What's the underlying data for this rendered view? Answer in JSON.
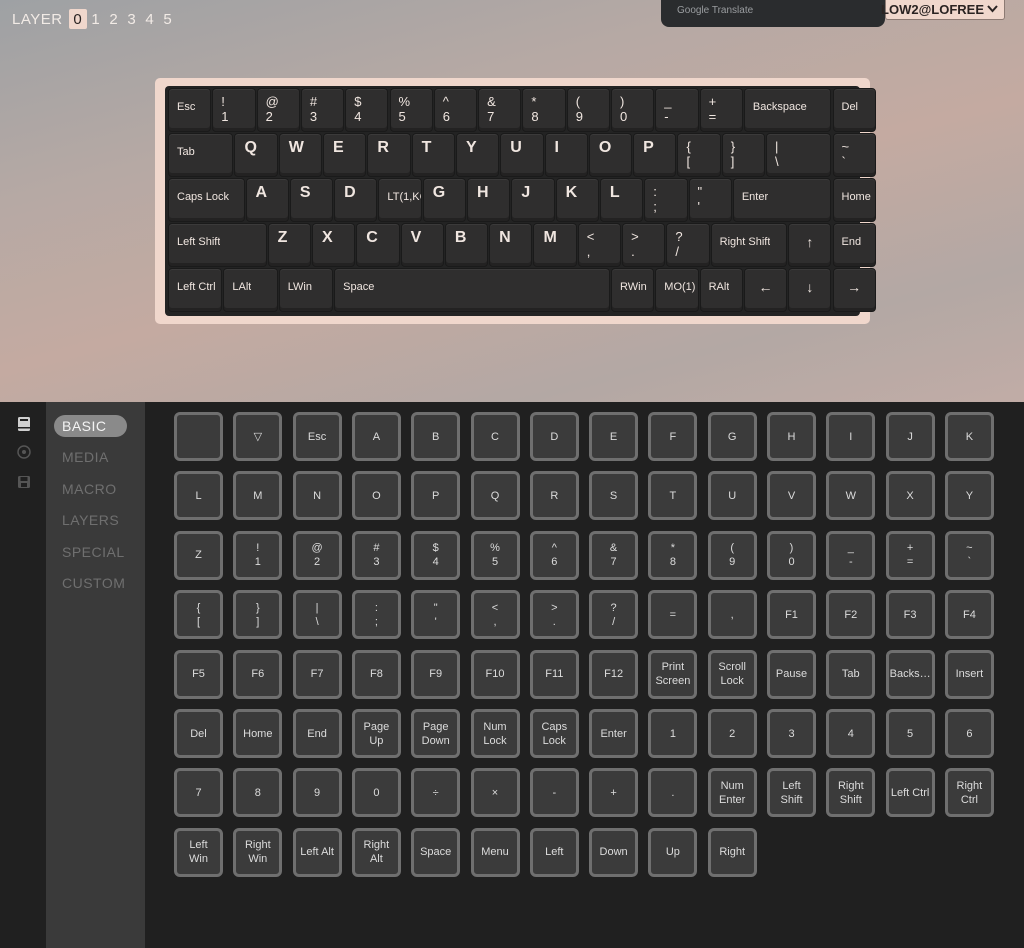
{
  "layer_selector": {
    "label": "LAYER",
    "layers": [
      "0",
      "1",
      "2",
      "3",
      "4",
      "5"
    ],
    "active": "0"
  },
  "popup": {
    "label": "Google Translate"
  },
  "device": {
    "name": "LOW2@LOFREE"
  },
  "keyboard": {
    "rows": [
      [
        {
          "label": "Esc",
          "w": 1
        },
        {
          "label": "!\n1",
          "w": 1
        },
        {
          "label": "@\n2",
          "w": 1
        },
        {
          "label": "#\n3",
          "w": 1
        },
        {
          "label": "$\n4",
          "w": 1
        },
        {
          "label": "%\n5",
          "w": 1
        },
        {
          "label": "^\n6",
          "w": 1
        },
        {
          "label": "&\n7",
          "w": 1
        },
        {
          "label": "*\n8",
          "w": 1
        },
        {
          "label": "(\n9",
          "w": 1
        },
        {
          "label": ")\n0",
          "w": 1
        },
        {
          "label": "_\n-",
          "w": 1
        },
        {
          "label": "+\n=",
          "w": 1
        },
        {
          "label": "Backspace",
          "w": 2
        },
        {
          "label": "Del",
          "w": 1
        }
      ],
      [
        {
          "label": "Tab",
          "w": 1.5
        },
        {
          "label": "Q",
          "w": 1,
          "big": true
        },
        {
          "label": "W",
          "w": 1,
          "big": true
        },
        {
          "label": "E",
          "w": 1,
          "big": true
        },
        {
          "label": "R",
          "w": 1,
          "big": true
        },
        {
          "label": "T",
          "w": 1,
          "big": true
        },
        {
          "label": "Y",
          "w": 1,
          "big": true
        },
        {
          "label": "U",
          "w": 1,
          "big": true
        },
        {
          "label": "I",
          "w": 1,
          "big": true
        },
        {
          "label": "O",
          "w": 1,
          "big": true
        },
        {
          "label": "P",
          "w": 1,
          "big": true
        },
        {
          "label": "{\n[",
          "w": 1
        },
        {
          "label": "}\n]",
          "w": 1
        },
        {
          "label": "|\n\\",
          "w": 1.5
        },
        {
          "label": "~\n`",
          "w": 1
        }
      ],
      [
        {
          "label": "Caps Lock",
          "w": 1.75
        },
        {
          "label": "A",
          "w": 1,
          "big": true
        },
        {
          "label": "S",
          "w": 1,
          "big": true
        },
        {
          "label": "D",
          "w": 1,
          "big": true
        },
        {
          "label": "LT(1,KC",
          "w": 1
        },
        {
          "label": "G",
          "w": 1,
          "big": true
        },
        {
          "label": "H",
          "w": 1,
          "big": true
        },
        {
          "label": "J",
          "w": 1,
          "big": true
        },
        {
          "label": "K",
          "w": 1,
          "big": true
        },
        {
          "label": "L",
          "w": 1,
          "big": true
        },
        {
          "label": ":\n;",
          "w": 1
        },
        {
          "label": "\"\n'",
          "w": 1
        },
        {
          "label": "Enter",
          "w": 2.25
        },
        {
          "label": "Home",
          "w": 1
        }
      ],
      [
        {
          "label": "Left Shift",
          "w": 2.25
        },
        {
          "label": "Z",
          "w": 1,
          "big": true
        },
        {
          "label": "X",
          "w": 1,
          "big": true
        },
        {
          "label": "C",
          "w": 1,
          "big": true
        },
        {
          "label": "V",
          "w": 1,
          "big": true
        },
        {
          "label": "B",
          "w": 1,
          "big": true
        },
        {
          "label": "N",
          "w": 1,
          "big": true
        },
        {
          "label": "M",
          "w": 1,
          "big": true
        },
        {
          "label": "<\n,",
          "w": 1
        },
        {
          "label": ">\n.",
          "w": 1
        },
        {
          "label": "?\n/",
          "w": 1
        },
        {
          "label": "Right Shift",
          "w": 1.75
        },
        {
          "label": "↑",
          "w": 1,
          "arrow": true
        },
        {
          "label": "End",
          "w": 1
        }
      ],
      [
        {
          "label": "Left Ctrl",
          "w": 1.25
        },
        {
          "label": "LAlt",
          "w": 1.25
        },
        {
          "label": "LWin",
          "w": 1.25
        },
        {
          "label": "Space",
          "w": 6.25
        },
        {
          "label": "RWin",
          "w": 1
        },
        {
          "label": "MO(1)",
          "w": 1
        },
        {
          "label": "RAlt",
          "w": 1
        },
        {
          "label": "←",
          "w": 1,
          "arrow": true
        },
        {
          "label": "↓",
          "w": 1,
          "arrow": true
        },
        {
          "label": "→",
          "w": 1,
          "arrow": true
        }
      ]
    ]
  },
  "sidebar": {
    "icons": [
      "book-icon",
      "circle-icon",
      "save-icon"
    ],
    "menu": [
      "BASIC",
      "MEDIA",
      "MACRO",
      "LAYERS",
      "SPECIAL",
      "CUSTOM"
    ],
    "active": "BASIC"
  },
  "keycodes": [
    "",
    "▽",
    "Esc",
    "A",
    "B",
    "C",
    "D",
    "E",
    "F",
    "G",
    "H",
    "I",
    "J",
    "K",
    "L",
    "M",
    "N",
    "O",
    "P",
    "Q",
    "R",
    "S",
    "T",
    "U",
    "V",
    "W",
    "X",
    "Y",
    "Z",
    "!\n1",
    "@\n2",
    "#\n3",
    "$\n4",
    "%\n5",
    "^\n6",
    "&\n7",
    "*\n8",
    "(\n9",
    ")\n0",
    "_\n-",
    "+\n=",
    "~\n`",
    "{\n[",
    "}\n]",
    "|\n\\",
    ":\n;",
    "\"\n'",
    "<\n,",
    ">\n.",
    "?\n/",
    "=",
    ",",
    "F1",
    "F2",
    "F3",
    "F4",
    "F5",
    "F6",
    "F7",
    "F8",
    "F9",
    "F10",
    "F11",
    "F12",
    "Print\nScreen",
    "Scroll\nLock",
    "Pause",
    "Tab",
    "Backs…",
    "Insert",
    "Del",
    "Home",
    "End",
    "Page\nUp",
    "Page\nDown",
    "Num\nLock",
    "Caps\nLock",
    "Enter",
    "1",
    "2",
    "3",
    "4",
    "5",
    "6",
    "7",
    "8",
    "9",
    "0",
    "÷",
    "×",
    "-",
    "+",
    ".",
    "Num\nEnter",
    "Left\nShift",
    "Right\nShift",
    "Left Ctrl",
    "Right\nCtrl",
    "Left\nWin",
    "Right\nWin",
    "Left Alt",
    "Right\nAlt",
    "Space",
    "Menu",
    "Left",
    "Down",
    "Up",
    "Right"
  ]
}
